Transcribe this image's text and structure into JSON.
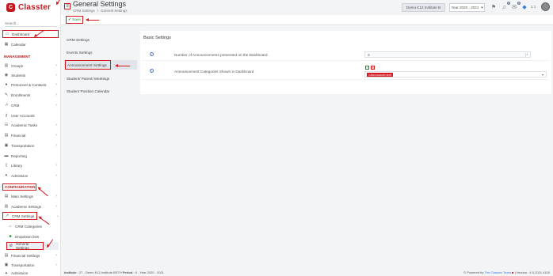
{
  "brand": {
    "name": "Classter"
  },
  "search": {
    "placeholder": "Search..."
  },
  "sidebar": {
    "dashboard": "Dashboard",
    "calendar": "Calendar",
    "management_header": "MANAGEMENT",
    "groups": "Groups",
    "students": "Students",
    "personnel": "Personnel & Contacts",
    "enrollments": "Enrollments",
    "crm": "CRM",
    "user_accounts": "User Accounts",
    "academic_tasks": "Academic Tasks",
    "financial": "Financial",
    "transportation": "Transportation",
    "reporting": "Reporting",
    "library": "Library",
    "admission": "Admission",
    "configuration_header": "CONFIGURATION",
    "main_settings": "Main Settings",
    "academic_settings": "Academic Settings",
    "crm_settings": "CRM Settings",
    "crm_categories": "CRM Categories",
    "dropdown_lists": "Dropdown lists",
    "general_settings": "General Settings",
    "financial_settings": "Financial Settings",
    "transportation2": "Transportation",
    "admission2": "Admission"
  },
  "header": {
    "title": "General Settings",
    "breadcrumb": [
      "CRM Settings",
      "/",
      "General Settings"
    ],
    "institute": "Demo K12 Institute B",
    "year": "Year 2020 - 2021",
    "page_count": "1 1",
    "badge_1": "0",
    "badge_2": "0"
  },
  "toolbar": {
    "save_label": "Save"
  },
  "submenu": {
    "items": [
      "CRM Settings",
      "Events Settings",
      "Announcement Settings",
      "Student/ Parent/ Meetings",
      "Student Position Calendar"
    ]
  },
  "main": {
    "title": "Basic Settings",
    "rows": [
      {
        "label": "Number of Announcements presented on the Dashboard",
        "value": "3"
      },
      {
        "label": "Announcement Categories Shown in Dashboard",
        "tag": "Announcement"
      }
    ]
  },
  "footer": {
    "institute_label": "Institute",
    "institute_value": ": 27 - Demo K12 Institute BETH",
    "period_label": "Period",
    "period_value": ": 9 - Year 2020 - 2021",
    "powered": "Powered by",
    "team": "The Classter Team",
    "version": "| Version : 4.0.2021.4100"
  },
  "colors": {
    "accent": "#d2191f",
    "brand": "#c4161c",
    "save": "#2a8a3a",
    "info": "#3c7bd8"
  }
}
